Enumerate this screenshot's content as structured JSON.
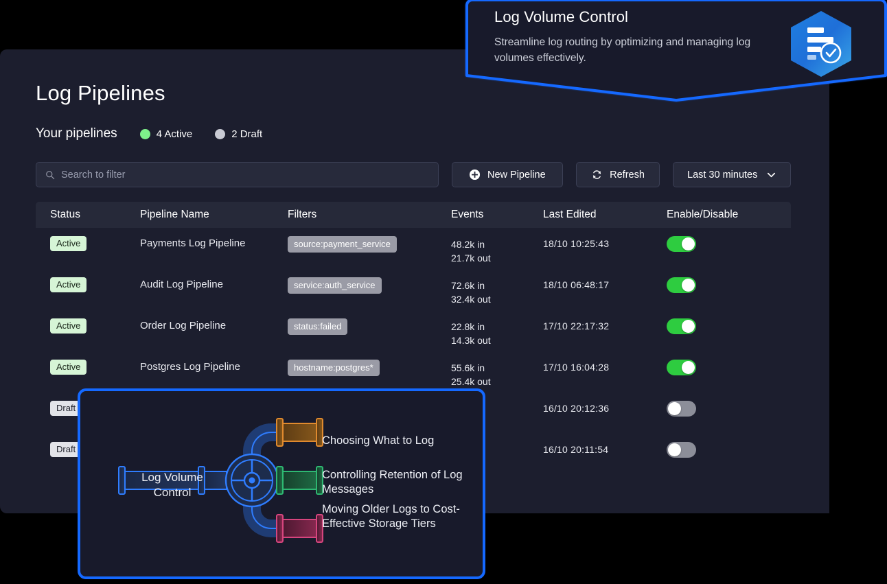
{
  "app": {
    "page_title": "Log Pipelines",
    "sub_title": "Your pipelines",
    "legend": [
      {
        "label": "4 Active",
        "color": "#7ef08a",
        "name": "active"
      },
      {
        "label": "2 Draft",
        "color": "#c9cbd4",
        "name": "draft"
      }
    ]
  },
  "toolbar": {
    "search_placeholder": "Search to filter",
    "search_value": "",
    "search_icon": "search-icon",
    "new_pipeline_label": "New Pipeline",
    "new_pipeline_icon": "plus-circle-icon",
    "refresh_label": "Refresh",
    "refresh_icon": "refresh-icon",
    "timerange_label": "Last 30 minutes",
    "timerange_icon": "chevron-down-icon"
  },
  "table": {
    "columns": [
      "Status",
      "Pipeline Name",
      "Filters",
      "Events",
      "Last Edited",
      "Enable/Disable"
    ],
    "rows": [
      {
        "status": "Active",
        "status_kind": "active",
        "name": "Payments Log Pipeline",
        "filter": "source:payment_service",
        "events_in": "48.2k in",
        "events_out": "21.7k out",
        "last_edited": "18/10  10:25:43",
        "enabled": true
      },
      {
        "status": "Active",
        "status_kind": "active",
        "name": "Audit Log Pipeline",
        "filter": "service:auth_service",
        "events_in": "72.6k in",
        "events_out": "32.4k out",
        "last_edited": "18/10  06:48:17",
        "enabled": true
      },
      {
        "status": "Active",
        "status_kind": "active",
        "name": "Order Log Pipeline",
        "filter": "status:failed",
        "events_in": "22.8k in",
        "events_out": "14.3k out",
        "last_edited": "17/10  22:17:32",
        "enabled": true
      },
      {
        "status": "Active",
        "status_kind": "active",
        "name": "Postgres Log Pipeline",
        "filter": "hostname:postgres*",
        "events_in": "55.6k in",
        "events_out": "25.4k out",
        "last_edited": "17/10  16:04:28",
        "enabled": true
      },
      {
        "status": "Draft",
        "status_kind": "draft",
        "name": "",
        "filter": "",
        "events_in": "",
        "events_out": "",
        "last_edited": "16/10  20:12:36",
        "enabled": false
      },
      {
        "status": "Draft",
        "status_kind": "draft",
        "name": "",
        "filter": "",
        "events_in": "",
        "events_out": "",
        "last_edited": "16/10  20:11:54",
        "enabled": false
      }
    ]
  },
  "popup_top": {
    "title": "Log Volume Control",
    "description": "Streamline log routing by optimizing and managing log volumes effectively.",
    "icon": "log-volume-hexagon-icon",
    "border_color": "#1569ff",
    "background": "#181a2b"
  },
  "popup_bottom": {
    "center_label": "Log Volume\nControl",
    "border_color": "#1569ff",
    "background": "#181a2b",
    "branches": [
      {
        "label": "Choosing What to Log",
        "color": "#e08a2e"
      },
      {
        "label": "Controlling Retention of Log Messages",
        "color": "#2eb872"
      },
      {
        "label": "Moving Older Logs to Cost-Effective Storage Tiers",
        "color": "#d6457e"
      }
    ]
  }
}
